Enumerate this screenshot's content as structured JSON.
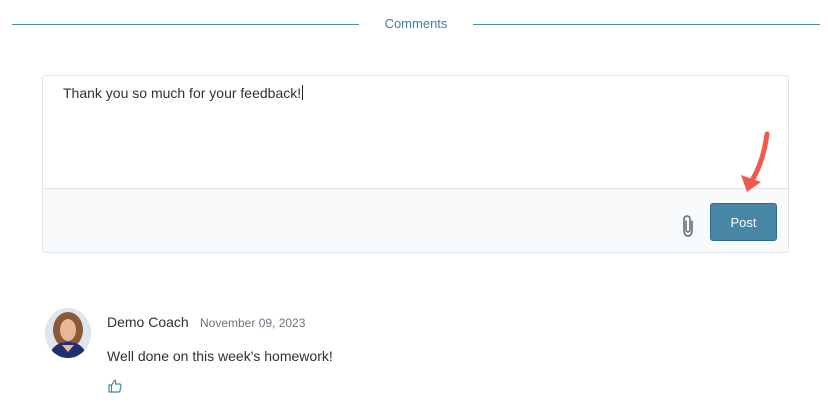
{
  "section": {
    "title": "Comments"
  },
  "composer": {
    "value": "Thank you so much for your feedback!",
    "post_label": "Post",
    "attach_icon": "paperclip-icon"
  },
  "comments": [
    {
      "author": "Demo Coach",
      "date": "November 09, 2023",
      "text": "Well done on this week's homework!",
      "like_icon": "thumbs-up-icon"
    }
  ],
  "colors": {
    "accent": "#4886a6",
    "divider": "#4b8ba8",
    "annotation_arrow": "#ef5b4a"
  }
}
